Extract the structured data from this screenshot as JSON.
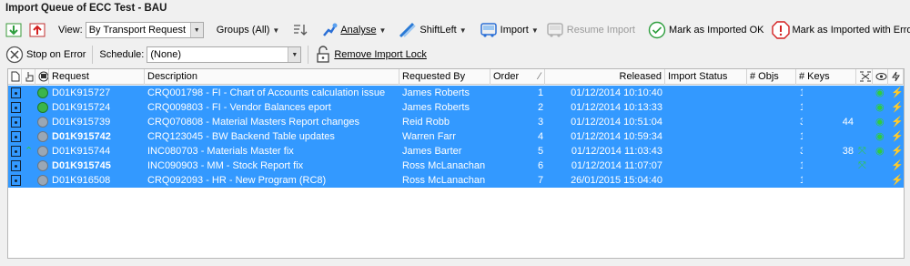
{
  "window": {
    "title": "Import Queue of ECC Test - BAU"
  },
  "toolbar": {
    "view_label": "View:",
    "view_value": "By Transport Request",
    "groups_label": "Groups (All)",
    "analyse_label": "Analyse",
    "shiftleft_label": "ShiftLeft",
    "import_label": "Import",
    "resume_label": "Resume Import",
    "mark_ok_label": "Mark as Imported OK",
    "mark_err_label": "Mark as Imported with Errors",
    "stop_label": "Stop on Error",
    "schedule_label": "Schedule:",
    "schedule_value": "(None)",
    "remove_lock_label": "Remove Import Lock"
  },
  "table": {
    "columns": {
      "request": "Request",
      "description": "Description",
      "requested_by": "Requested By",
      "order": "Order",
      "released": "Released",
      "import_status": "Import Status",
      "objs": "# Objs",
      "keys": "# Keys"
    },
    "rows": [
      {
        "request": "D01K915727",
        "description": "CRQ001798 - FI - Chart of Accounts calculation issue",
        "requested_by": "James Roberts",
        "order": "1",
        "released": "01/12/2014 10:10:40",
        "import_status": "",
        "objs": "1",
        "keys": "",
        "status_icon": "green",
        "bold": false,
        "alert": false
      },
      {
        "request": "D01K915724",
        "description": "CRQ009803 - FI - Vendor Balances eport",
        "requested_by": "James Roberts",
        "order": "2",
        "released": "01/12/2014 10:13:33",
        "import_status": "",
        "objs": "1",
        "keys": "",
        "status_icon": "green",
        "bold": false,
        "alert": false
      },
      {
        "request": "D01K915739",
        "description": "CRQ070808 - Material Masters Report changes",
        "requested_by": "Reid Robb",
        "order": "3",
        "released": "01/12/2014 10:51:04",
        "import_status": "",
        "objs": "3",
        "keys": "44",
        "status_icon": "grey",
        "bold": false,
        "alert": false
      },
      {
        "request": "D01K915742",
        "description": "CRQ123045 - BW Backend Table updates",
        "requested_by": "Warren Farr",
        "order": "4",
        "released": "01/12/2014 10:59:34",
        "import_status": "",
        "objs": "1",
        "keys": "",
        "status_icon": "grey",
        "bold": true,
        "alert": false
      },
      {
        "request": "D01K915744",
        "description": "INC080703 - Materials Master fix",
        "requested_by": "James Barter",
        "order": "5",
        "released": "01/12/2014 11:03:43",
        "import_status": "",
        "objs": "3",
        "keys": "38",
        "status_icon": "grey",
        "bold": false,
        "alert": true
      },
      {
        "request": "D01K915745",
        "description": "INC090903 - MM - Stock Report fix",
        "requested_by": "Ross McLanachan",
        "order": "6",
        "released": "01/12/2014 11:07:07",
        "import_status": "",
        "objs": "1",
        "keys": "",
        "status_icon": "grey",
        "bold": true,
        "alert": false
      },
      {
        "request": "D01K916508",
        "description": "CRQ092093 - HR - New Program (RC8)",
        "requested_by": "Ross McLanachan",
        "order": "7",
        "released": "26/01/2015 15:04:40",
        "import_status": "",
        "objs": "1",
        "keys": "",
        "status_icon": "grey",
        "bold": false,
        "alert": false
      }
    ]
  },
  "colors": {
    "selection": "#3399ff",
    "ok_green": "#2e9e3e",
    "error_red": "#d42020"
  }
}
